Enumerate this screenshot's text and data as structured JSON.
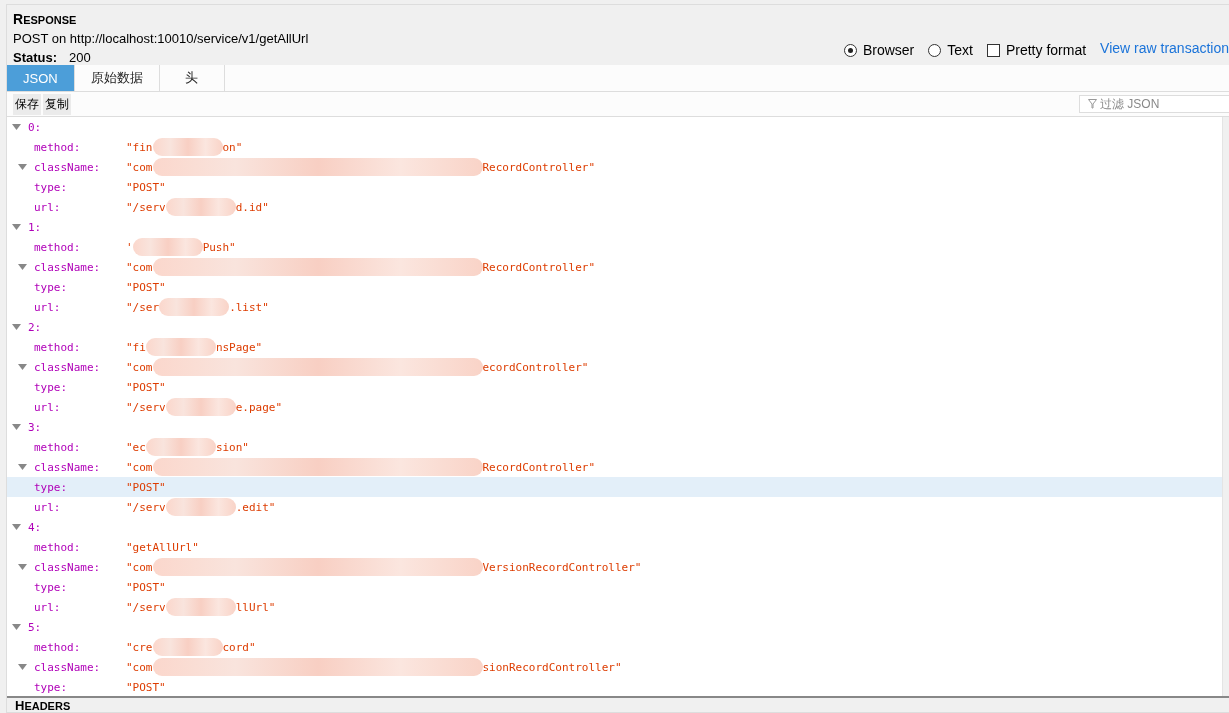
{
  "response": {
    "heading": "RESPONSE",
    "request": "POST on http://localhost:10010/service/v1/getAllUrl",
    "status_label": "Status:",
    "status": "200"
  },
  "view_options": [
    {
      "label": "Browser",
      "kind": "radio",
      "selected": true
    },
    {
      "label": "Text",
      "kind": "radio",
      "selected": false
    },
    {
      "label": "Pretty format",
      "kind": "checkbox",
      "selected": false
    }
  ],
  "raw_link": "View raw transaction",
  "tabs": [
    {
      "label": "JSON",
      "selected": true
    },
    {
      "label": "原始数据",
      "selected": false
    },
    {
      "label": "头",
      "selected": false
    }
  ],
  "toolbar": {
    "buttons": [
      "保存",
      "复制"
    ],
    "filter": {
      "placeholder": "过滤 JSON"
    }
  },
  "tree": [
    {
      "index": "0:",
      "expanded": true,
      "fields": [
        {
          "key": "method:",
          "kind": "leaf",
          "head": "\"fin",
          "tail": "on\"",
          "redacted": true,
          "selected": false
        },
        {
          "key": "className:",
          "kind": "node",
          "expanded": true,
          "head": "\"com",
          "tail": "RecordController\"",
          "redacted": true,
          "selected": false
        },
        {
          "key": "type:",
          "kind": "leaf",
          "head": "\"POST\"",
          "redacted": false,
          "selected": false
        },
        {
          "key": "url:",
          "kind": "leaf",
          "head": "\"/serv",
          "tail": "d.id\"",
          "redacted": true,
          "selected": false
        }
      ]
    },
    {
      "index": "1:",
      "expanded": true,
      "fields": [
        {
          "key": "method:",
          "kind": "leaf",
          "head": "'",
          "tail": "Push\"",
          "redacted": true,
          "selected": false
        },
        {
          "key": "className:",
          "kind": "node",
          "expanded": true,
          "head": "\"com",
          "tail": "RecordController\"",
          "redacted": true,
          "selected": false
        },
        {
          "key": "type:",
          "kind": "leaf",
          "head": "\"POST\"",
          "redacted": false,
          "selected": false
        },
        {
          "key": "url:",
          "kind": "leaf",
          "head": "\"/ser",
          "tail": ".list\"",
          "redacted": true,
          "selected": false
        }
      ]
    },
    {
      "index": "2:",
      "expanded": true,
      "fields": [
        {
          "key": "method:",
          "kind": "leaf",
          "head": "\"fi",
          "tail": "nsPage\"",
          "redacted": true,
          "selected": false
        },
        {
          "key": "className:",
          "kind": "node",
          "expanded": true,
          "head": "\"com",
          "tail": "ecordController\"",
          "redacted": true,
          "selected": false
        },
        {
          "key": "type:",
          "kind": "leaf",
          "head": "\"POST\"",
          "redacted": false,
          "selected": false
        },
        {
          "key": "url:",
          "kind": "leaf",
          "head": "\"/serv",
          "tail": "e.page\"",
          "redacted": true,
          "selected": false
        }
      ]
    },
    {
      "index": "3:",
      "expanded": true,
      "fields": [
        {
          "key": "method:",
          "kind": "leaf",
          "head": "\"ec",
          "tail": "sion\"",
          "redacted": true,
          "selected": false
        },
        {
          "key": "className:",
          "kind": "node",
          "expanded": true,
          "head": "\"com",
          "tail": "RecordController\"",
          "redacted": true,
          "selected": false
        },
        {
          "key": "type:",
          "kind": "leaf",
          "head": "\"POST\"",
          "redacted": false,
          "selected": true
        },
        {
          "key": "url:",
          "kind": "leaf",
          "head": "\"/serv",
          "tail": ".edit\"",
          "redacted": true,
          "selected": false
        }
      ]
    },
    {
      "index": "4:",
      "expanded": true,
      "fields": [
        {
          "key": "method:",
          "kind": "leaf",
          "head": "\"getAllUrl\"",
          "redacted": false,
          "selected": false
        },
        {
          "key": "className:",
          "kind": "node",
          "expanded": true,
          "head": "\"com",
          "tail": "VersionRecordController\"",
          "redacted": true,
          "selected": false
        },
        {
          "key": "type:",
          "kind": "leaf",
          "head": "\"POST\"",
          "redacted": false,
          "selected": false
        },
        {
          "key": "url:",
          "kind": "leaf",
          "head": "\"/serv",
          "tail": "llUrl\"",
          "redacted": true,
          "selected": false
        }
      ]
    },
    {
      "index": "5:",
      "expanded": true,
      "fields": [
        {
          "key": "method:",
          "kind": "leaf",
          "head": "\"cre",
          "tail": "cord\"",
          "redacted": true,
          "selected": false
        },
        {
          "key": "className:",
          "kind": "node",
          "expanded": true,
          "head": "\"com",
          "tail": "sionRecordController\"",
          "redacted": true,
          "selected": false
        },
        {
          "key": "type:",
          "kind": "leaf",
          "head": "\"POST\"",
          "redacted": false,
          "selected": false
        }
      ]
    }
  ],
  "headers_heading": "HEADERS"
}
